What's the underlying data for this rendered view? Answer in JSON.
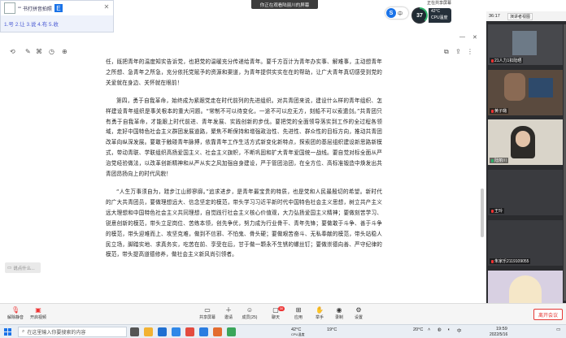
{
  "ime": {
    "row1_text": "\"\" 书打拼音拍照",
    "row2_text": "1.号 2.让 3.说 4.布 5.收",
    "e_label": "E"
  },
  "topbar": {
    "sharing_text": "你正在观看陆丽川的屏幕",
    "right_text": "正在共享屏幕",
    "ime_label": "中",
    "cpu_percent": "37",
    "cpu_temp": "42°C",
    "cpu_temp_label": "CPU温度"
  },
  "panel": {
    "time": "36:17",
    "view_btn": "演讲者视图",
    "tiles": [
      {
        "label": "21人力1扣陆晒"
      },
      {
        "label": "黄子璐"
      },
      {
        "label": "陆丽川"
      },
      {
        "label": "王玲"
      },
      {
        "label": "朱家乐2119109055"
      },
      {
        "label": ""
      }
    ]
  },
  "document": {
    "paragraphs": [
      "任，既把青年的温度知实告诉党，也把党的温暖充分传递给青年。要千方百计为青年办实事、解难事，主动想青年之所想、急青年之所急，充分依托党赋予的资源和渠道，为青年提供实实在在的帮助，让广大青年真切感受到党的关爱就在身边、关怀就在眼前！",
      "第四，勇于自我革命，始终成为紧跟党走在时代前列的先进组织。对共青团来说，建设什么样的青年组织、怎样建设青年组织是事关根本的重大问题。“常制不可以待变化，一途不可以应无方，刻船不可以索遗剑。”共青团只有勇于自我革命，才能跟上时代前进、青年发展、实践创新的步伐。要把党的全面领导落实到工作的全过程各领域，走好中国特色社会主义群团发展道路，聚焦不断保持和增强政治性、先进性、群众性的目标方向，推动共青团改革向纵深发展。要敢于触碰青年脉搏，依靠青年工作生活方式新变化新特点，探索团的基层组织建设新思路新模式，带动青联、学联组织高扬爱国主义、社会主义旗帜，不断巩固和扩大青年爱国统一战线。要自觉对标全面从严治党经验做法，以改革创新精神和从严从实之风加强自身建设，严于管团治团，在全方位、高标准锻造中焕发出共青团昂扬向上的时代风貌！",
      "“人生万事须自为，跬步江山即寥廓。”追求进步，是青年最宝贵的特质，也是党和人民最殷切的希望。新时代的广大共青团员，要做理想远大、信念坚定的模范，带头学习习近平新时代中国特色社会主义思想，树立共产主义远大理想和中国特色社会主义共同理想，自觉践行社会主义核心价值观，大力弘扬爱国主义精神；要做刻苦学习、锐意创新的模范，带头立足岗位、苦练本领，创先争优，努力成为行业骨干、青年先锋；要做敢于斗争、善于斗争的模范，带头迎难而上、攻坚克难，做到不信邪、不怕鬼、骨头硬；要做艰苦奋斗、无私奉献的模范，带头站稳人民立场，脚踏实地、求真务实，吃苦在前、享受在后，甘于做一颗永不生锈的螺丝钉；要做崇德向善、严守纪律的模范，带头提高道德修养，做社会主义新风尚引领者。"
    ],
    "search_pill": "说点什么..."
  },
  "controls": {
    "mic": "解除静音",
    "camera": "开启视频",
    "items": [
      "共享屏幕",
      "邀请",
      "成员(25)",
      "聊天",
      "应用",
      "举手",
      "录制",
      "设置"
    ],
    "chat_badge": "30",
    "leave": "离开会议"
  },
  "taskbar": {
    "search_placeholder": "在这里输入你要搜索的内容",
    "cpu_temp": "42°C",
    "cpu_label": "CPU温度",
    "weather": "19°C",
    "weather2": "20°C",
    "time": "19:59",
    "date": "2022/5/16"
  }
}
